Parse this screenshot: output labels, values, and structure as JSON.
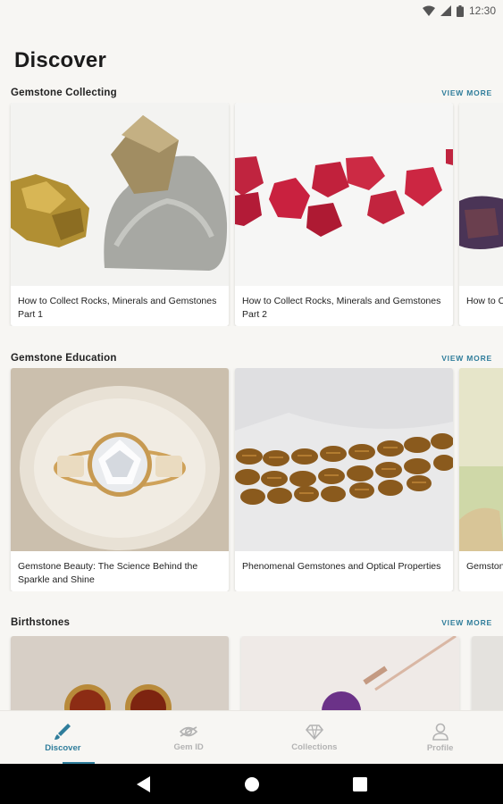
{
  "status": {
    "time": "12:30"
  },
  "page": {
    "title": "Discover"
  },
  "sections": [
    {
      "title": "Gemstone Collecting",
      "view_more": "VIEW MORE",
      "cards": [
        {
          "title": "How to Collect Rocks, Minerals and Gemstones Part 1"
        },
        {
          "title": "How to Collect Rocks, Minerals and Gemstones Part 2"
        },
        {
          "title": "How to Collect Rocks, Minerals and Gemstones"
        }
      ]
    },
    {
      "title": "Gemstone Education",
      "view_more": "VIEW MORE",
      "cards": [
        {
          "title": "Gemstone Beauty: The Science Behind the Sparkle and Shine"
        },
        {
          "title": "Phenomenal Gemstones and Optical Properties"
        },
        {
          "title": "Gemstones"
        }
      ]
    },
    {
      "title": "Birthstones",
      "view_more": "VIEW MORE",
      "cards": [
        {
          "title": ""
        },
        {
          "title": ""
        },
        {
          "title": ""
        }
      ]
    }
  ],
  "nav": [
    {
      "label": "Discover",
      "icon": "pen-brush-icon"
    },
    {
      "label": "Gem ID",
      "icon": "gem-eye-icon"
    },
    {
      "label": "Collections",
      "icon": "diamond-icon"
    },
    {
      "label": "Profile",
      "icon": "person-icon"
    }
  ],
  "colors": {
    "accent": "#2f7d9b",
    "inactive": "#b3b3b3",
    "background": "#f7f6f3"
  }
}
